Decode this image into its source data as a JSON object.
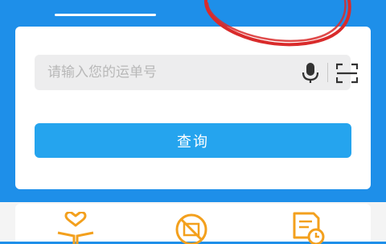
{
  "search": {
    "placeholder": "请输入您的运单号",
    "value": ""
  },
  "actions": {
    "query_label": "查询"
  },
  "icons": {
    "mic": "microphone-icon",
    "scan": "scan-icon",
    "shortcut_1": "heart-book-icon",
    "shortcut_2": "prohibited-package-icon",
    "shortcut_3": "document-clock-icon"
  },
  "colors": {
    "background": "#1e8fe9",
    "button": "#25a4ee",
    "icon_orange": "#f3a01d",
    "annotation_red": "#d92b2b"
  }
}
